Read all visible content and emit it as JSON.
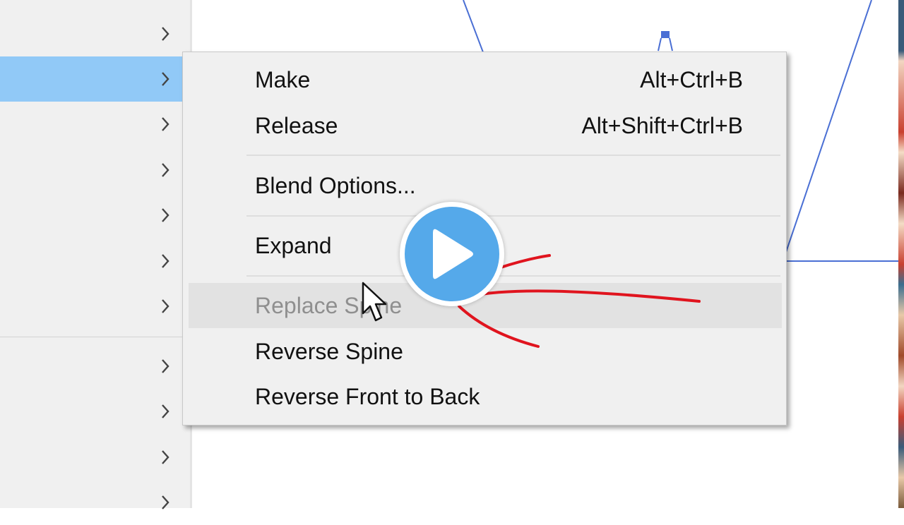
{
  "colors": {
    "menu_bg": "#f0f0f0",
    "active_row": "#91c9f7",
    "disabled_text": "#8f8f8f",
    "artwork_line": "#4a6fd4",
    "annotation_red": "#e0141e",
    "play_blue": "#55a9ea"
  },
  "parent_menu": {
    "rows": [
      {
        "icon": "chevron-right-icon",
        "active": false
      },
      {
        "icon": "chevron-right-icon",
        "active": true
      },
      {
        "icon": "chevron-right-icon",
        "active": false
      },
      {
        "icon": "chevron-right-icon",
        "active": false
      },
      {
        "icon": "chevron-right-icon",
        "active": false
      },
      {
        "icon": "chevron-right-icon",
        "active": false
      },
      {
        "icon": "chevron-right-icon",
        "active": false
      },
      {
        "icon": "chevron-right-icon",
        "active": false
      },
      {
        "icon": "chevron-right-icon",
        "active": false
      },
      {
        "icon": "chevron-right-icon",
        "active": false
      },
      {
        "icon": "chevron-right-icon",
        "active": false
      }
    ]
  },
  "submenu": {
    "items": [
      {
        "label": "Make",
        "shortcut": "Alt+Ctrl+B",
        "disabled": false
      },
      {
        "label": "Release",
        "shortcut": "Alt+Shift+Ctrl+B",
        "disabled": false
      },
      {
        "label": "Blend Options...",
        "shortcut": "",
        "disabled": false
      },
      {
        "label": "Expand",
        "shortcut": "",
        "disabled": false
      },
      {
        "label": "Replace Spine",
        "shortcut": "",
        "disabled": true
      },
      {
        "label": "Reverse Spine",
        "shortcut": "",
        "disabled": false
      },
      {
        "label": "Reverse Front to Back",
        "shortcut": "",
        "disabled": false
      }
    ]
  },
  "overlay": {
    "play_icon": "play-icon",
    "cursor_icon": "mouse-cursor-icon"
  }
}
